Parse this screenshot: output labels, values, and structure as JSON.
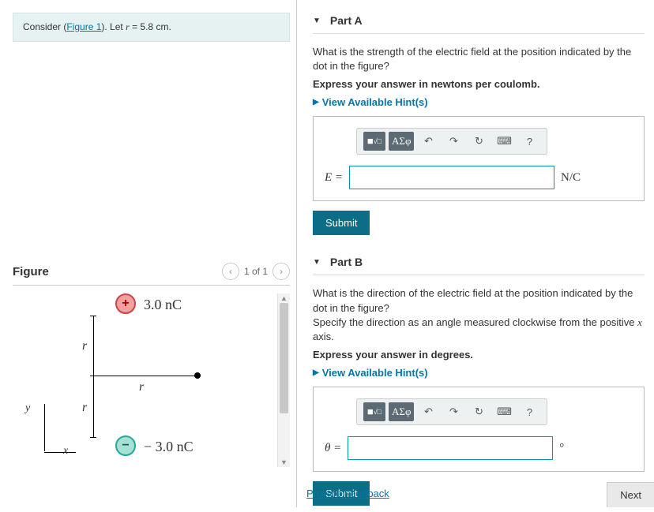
{
  "prompt": {
    "prefix": "Consider (",
    "link_text": "Figure 1",
    "suffix": "). Let ",
    "var": "r",
    "rest": " = 5.8 cm."
  },
  "figure": {
    "title": "Figure",
    "counter": "1 of 1",
    "pos_label": "3.0 nC",
    "neg_label": "− 3.0 nC",
    "r": "r",
    "axis_x": "x",
    "axis_y": "y",
    "pos_sign": "+",
    "neg_sign": "−"
  },
  "part_a": {
    "title": "Part A",
    "question": "What is the strength of the electric field at the position indicated by the dot in the figure?",
    "instruction": "Express your answer in newtons per coulomb.",
    "hints_label": "View Available Hint(s)",
    "lhs": "E =",
    "unit": "N/C",
    "submit": "Submit"
  },
  "part_b": {
    "title": "Part B",
    "question_line1": "What is the direction of the electric field at the position indicated by the dot in the figure?",
    "question_line2_pre": "Specify the direction as an angle measured clockwise from the positive ",
    "question_line2_var": "x",
    "question_line2_post": " axis.",
    "instruction": "Express your answer in degrees.",
    "hints_label": "View Available Hint(s)",
    "lhs": "θ =",
    "unit": "°",
    "submit": "Submit"
  },
  "toolbar": {
    "templates": "■",
    "radical": "√□",
    "greek": "ΑΣφ",
    "undo": "↶",
    "redo": "↷",
    "reset": "↻",
    "keyboard": "⌨",
    "help": "?"
  },
  "footer": {
    "feedback": "Provide Feedback",
    "next": "Next"
  }
}
